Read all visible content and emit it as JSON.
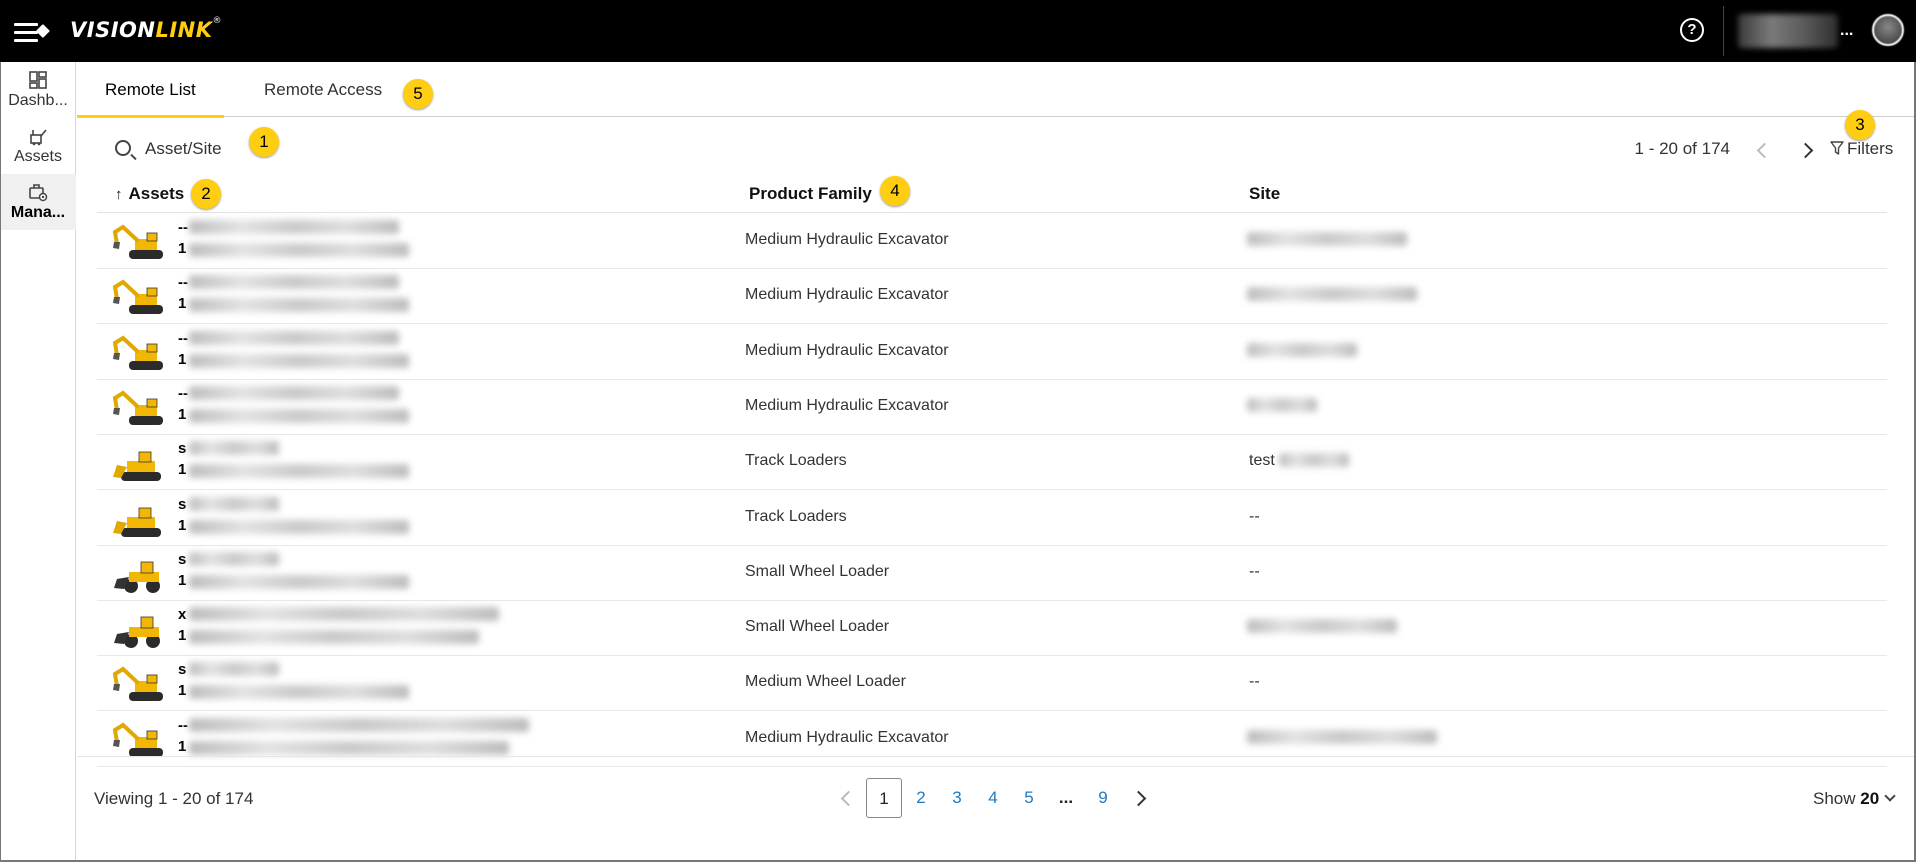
{
  "app": {
    "logo_part1": "VISION",
    "logo_part2": "LINK",
    "logo_mark": "®",
    "account_ellipsis": "..."
  },
  "sidebar": {
    "items": [
      {
        "label": "Dashb..."
      },
      {
        "label": "Assets"
      },
      {
        "label": "Mana..."
      }
    ]
  },
  "tabs": [
    {
      "label": "Remote List",
      "active": true
    },
    {
      "label": "Remote Access",
      "active": false
    }
  ],
  "callouts": [
    "1",
    "2",
    "3",
    "4",
    "5"
  ],
  "toolbar": {
    "search_label": "Asset/Site",
    "range": "1 - 20 of 174",
    "filters_label": "Filters"
  },
  "table": {
    "columns": [
      "Assets",
      "Product Family",
      "Site"
    ],
    "sort_indicator": "↑",
    "rows": [
      {
        "line1": "--",
        "line2": "1",
        "product_family": "Medium Hydraulic Excavator",
        "site": "",
        "machine": "excavator"
      },
      {
        "line1": "--",
        "line2": "1",
        "product_family": "Medium Hydraulic Excavator",
        "site": "",
        "machine": "excavator"
      },
      {
        "line1": "--",
        "line2": "1",
        "product_family": "Medium Hydraulic Excavator",
        "site": "",
        "machine": "excavator"
      },
      {
        "line1": "--",
        "line2": "1",
        "product_family": "Medium Hydraulic Excavator",
        "site": "",
        "machine": "excavator"
      },
      {
        "line1": "s",
        "line2": "1",
        "product_family": "Track Loaders",
        "site": "test",
        "machine": "track-loader"
      },
      {
        "line1": "s",
        "line2": "1",
        "product_family": "Track Loaders",
        "site": "--",
        "machine": "track-loader"
      },
      {
        "line1": "s",
        "line2": "1",
        "product_family": "Small Wheel Loader",
        "site": "--",
        "machine": "wheel-loader"
      },
      {
        "line1": "x",
        "line2": "1",
        "product_family": "Small Wheel Loader",
        "site": "",
        "machine": "wheel-loader"
      },
      {
        "line1": "s",
        "line2": "1",
        "product_family": "Medium Wheel Loader",
        "site": "--",
        "machine": "excavator"
      },
      {
        "line1": "--",
        "line2": "1",
        "product_family": "Medium Hydraulic Excavator",
        "site": "",
        "machine": "excavator"
      }
    ]
  },
  "footer": {
    "viewing": "Viewing 1 - 20 of 174",
    "pages": [
      "1",
      "2",
      "3",
      "4",
      "5",
      "...",
      "9"
    ],
    "current_page": "1",
    "show_label": "Show",
    "show_value": "20"
  },
  "colors": {
    "accent": "#ffcd11",
    "topbar": "#000000",
    "link": "#1f7ac3"
  }
}
